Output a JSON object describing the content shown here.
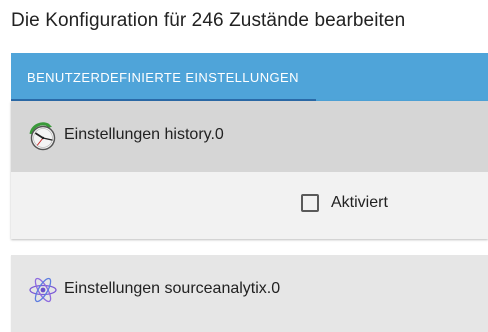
{
  "dialog": {
    "title": "Die Konfiguration für 246 Zustände bearbeiten"
  },
  "tabs": [
    {
      "label": "BENUTZERDEFINIERTE EINSTELLUNGEN",
      "active": true
    }
  ],
  "colors": {
    "tabbar": "#4fa4d9",
    "tab_indicator": "#2b6aa8",
    "panel_header": "#d6d6d6"
  },
  "panels": [
    {
      "title": "Einstellungen history.0",
      "icon": "history-clock-icon",
      "expanded": true,
      "options": [
        {
          "label": "Aktiviert",
          "checked": false
        }
      ]
    },
    {
      "title": "Einstellungen sourceanalytix.0",
      "icon": "sourceanalytix-atom-icon",
      "expanded": false
    }
  ]
}
